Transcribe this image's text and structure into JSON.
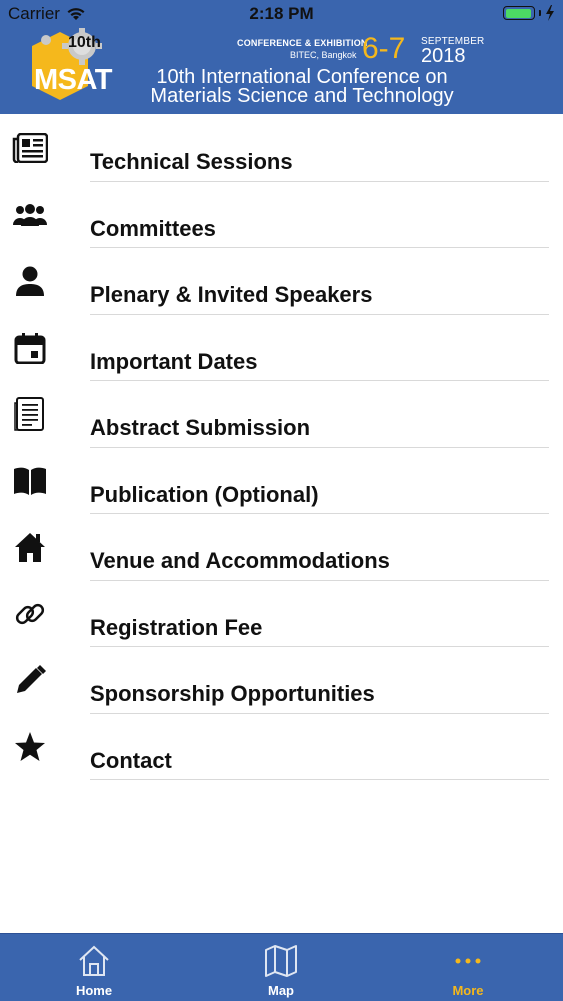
{
  "status_bar": {
    "carrier": "Carrier",
    "time": "2:18 PM"
  },
  "banner": {
    "logo_ordinal": "10th",
    "logo_text": "MSAT",
    "event_type": "CONFERENCE & EXHIBITION",
    "venue": "BITEC, Bangkok",
    "dates": "6-7",
    "month": "SEPTEMBER",
    "year": "2018",
    "title_line1": "10th International Conference on",
    "title_line2": "Materials Science and Technology"
  },
  "menu": {
    "items": [
      {
        "label": "Technical Sessions",
        "icon": "newspaper-icon"
      },
      {
        "label": "Committees",
        "icon": "people-group-icon"
      },
      {
        "label": "Plenary & Invited Speakers",
        "icon": "person-icon"
      },
      {
        "label": "Important Dates",
        "icon": "calendar-icon"
      },
      {
        "label": "Abstract Submission",
        "icon": "document-icon"
      },
      {
        "label": "Publication (Optional)",
        "icon": "book-icon"
      },
      {
        "label": "Venue and Accommodations",
        "icon": "home-icon"
      },
      {
        "label": "Registration Fee",
        "icon": "link-icon"
      },
      {
        "label": "Sponsorship Opportunities",
        "icon": "pencil-icon"
      },
      {
        "label": "Contact",
        "icon": "star-icon"
      }
    ]
  },
  "tab_bar": {
    "tabs": [
      {
        "label": "Home",
        "icon": "home-outline-icon"
      },
      {
        "label": "Map",
        "icon": "map-icon"
      },
      {
        "label": "More",
        "icon": "more-dots-icon",
        "active": true
      }
    ]
  },
  "colors": {
    "brand_blue": "#3a65ae",
    "accent_gold": "#f5b81c"
  }
}
